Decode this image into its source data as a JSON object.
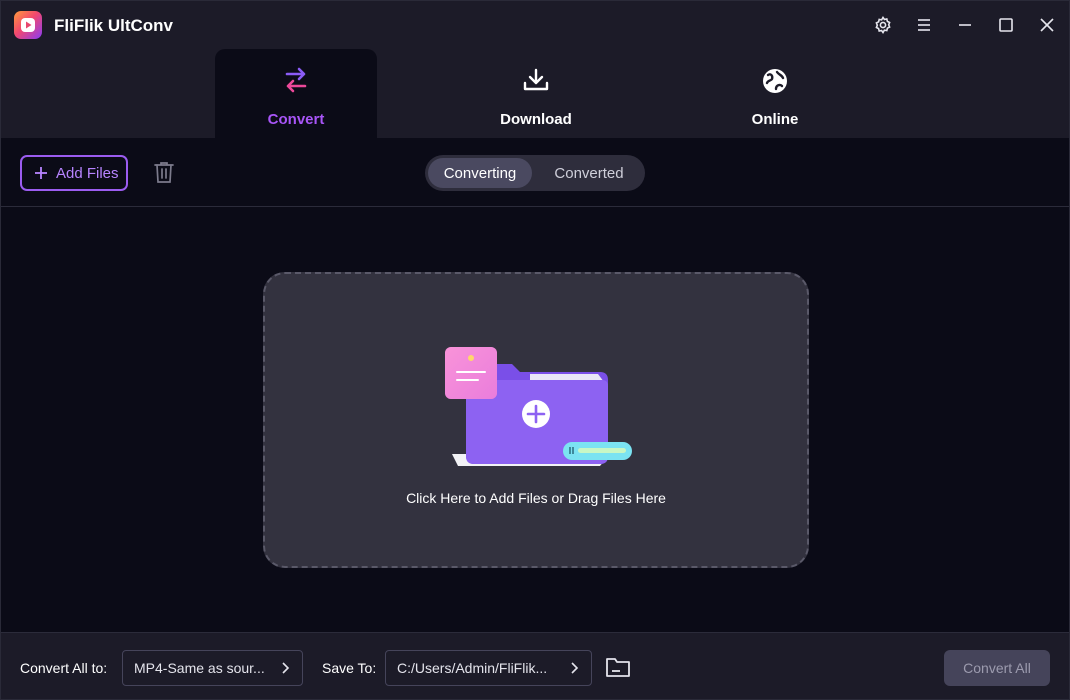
{
  "app": {
    "title": "FliFlik UltConv"
  },
  "tabs": [
    {
      "label": "Convert",
      "icon": "convert-arrows-icon",
      "active": true
    },
    {
      "label": "Download",
      "icon": "download-icon",
      "active": false
    },
    {
      "label": "Online",
      "icon": "globe-icon",
      "active": false
    }
  ],
  "toolbar": {
    "add_files_label": "Add Files",
    "segment": {
      "converting_label": "Converting",
      "converted_label": "Converted",
      "selected": "Converting"
    }
  },
  "dropzone": {
    "text": "Click Here to Add Files or Drag Files Here"
  },
  "bottom": {
    "convert_all_to_label": "Convert All to:",
    "format_value": "MP4-Same as sour...",
    "save_to_label": "Save To:",
    "save_path_value": "C:/Users/Admin/FliFlik...",
    "convert_all_label": "Convert All"
  },
  "colors": {
    "accent": "#a855f7",
    "header_bg": "#1c1b28",
    "main_bg": "#0b0b17",
    "dropzone_bg": "#33323f"
  }
}
